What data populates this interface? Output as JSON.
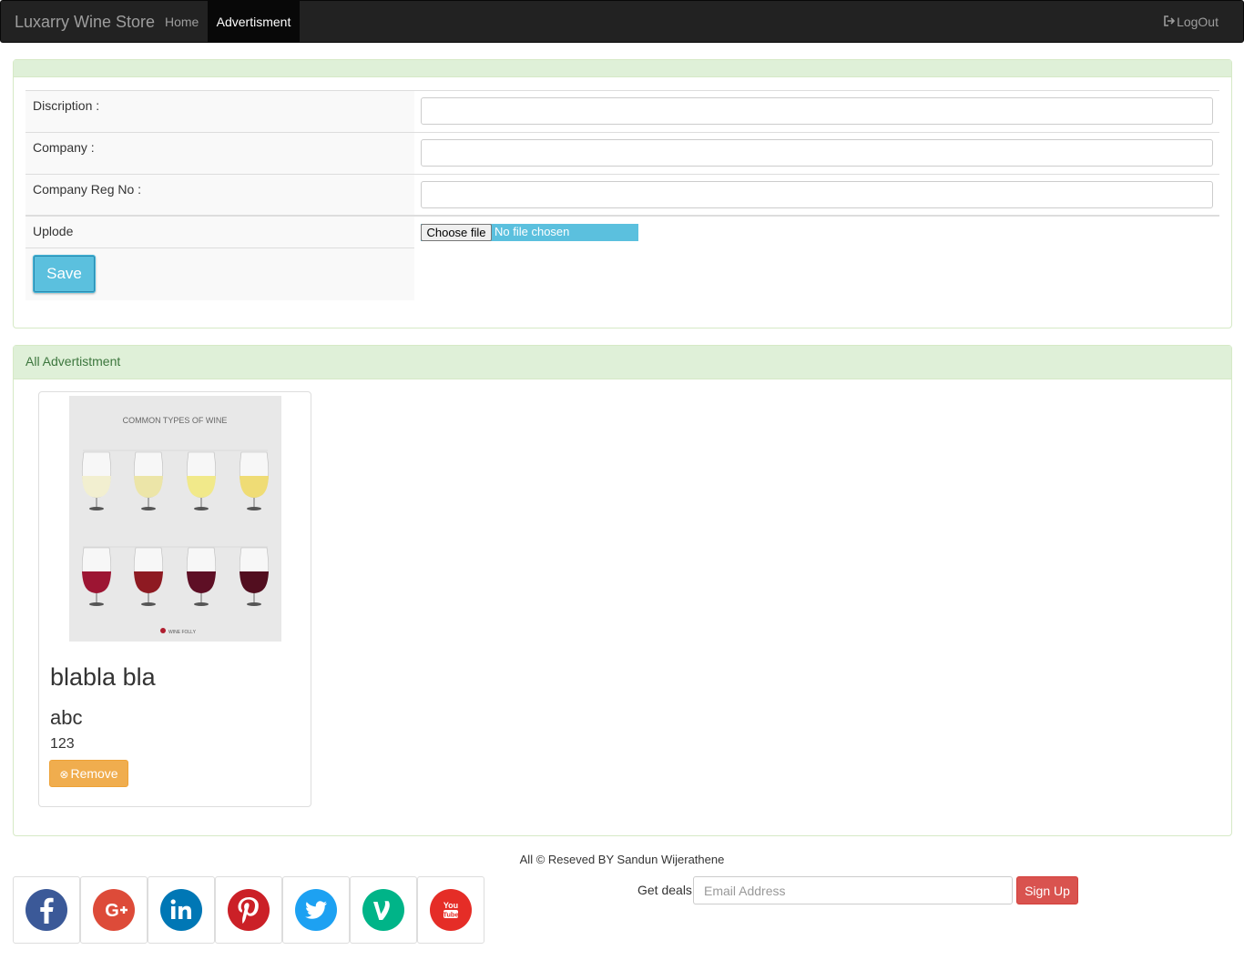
{
  "navbar": {
    "brand": "Luxarry Wine Store",
    "home": "Home",
    "advertisment": "Advertisment",
    "logout": "LogOut",
    "logout_icon": "log-out-icon"
  },
  "form": {
    "description_label": "Discription :",
    "company_label": "Company :",
    "reg_label": "Company Reg No :",
    "upload_label": "Uplode",
    "choose_file": "Choose file",
    "no_file": "No file chosen",
    "save": "Save",
    "description_value": "",
    "company_value": "",
    "reg_value": ""
  },
  "ads": {
    "heading": "All Advertistment",
    "items": [
      {
        "title": "blabla bla",
        "company": "abc",
        "reg_no": "123",
        "remove": "Remove",
        "image_heading": "COMMON TYPES OF WINE",
        "image_brand": "WINE FOLLY"
      }
    ]
  },
  "footer": {
    "copyright": "All © Reseved BY Sandun Wijerathene",
    "deals_label": "Get deals:",
    "email_placeholder": "Email Address",
    "signup": "Sign Up",
    "social": [
      {
        "name": "facebook-icon",
        "color": "#3b5998"
      },
      {
        "name": "google-plus-icon",
        "color": "#dd4b39"
      },
      {
        "name": "linkedin-icon",
        "color": "#0077b5"
      },
      {
        "name": "pinterest-icon",
        "color": "#cb2027"
      },
      {
        "name": "twitter-icon",
        "color": "#1da1f2"
      },
      {
        "name": "vine-icon",
        "color": "#00b488"
      },
      {
        "name": "youtube-icon",
        "color": "#e52d27"
      }
    ]
  }
}
